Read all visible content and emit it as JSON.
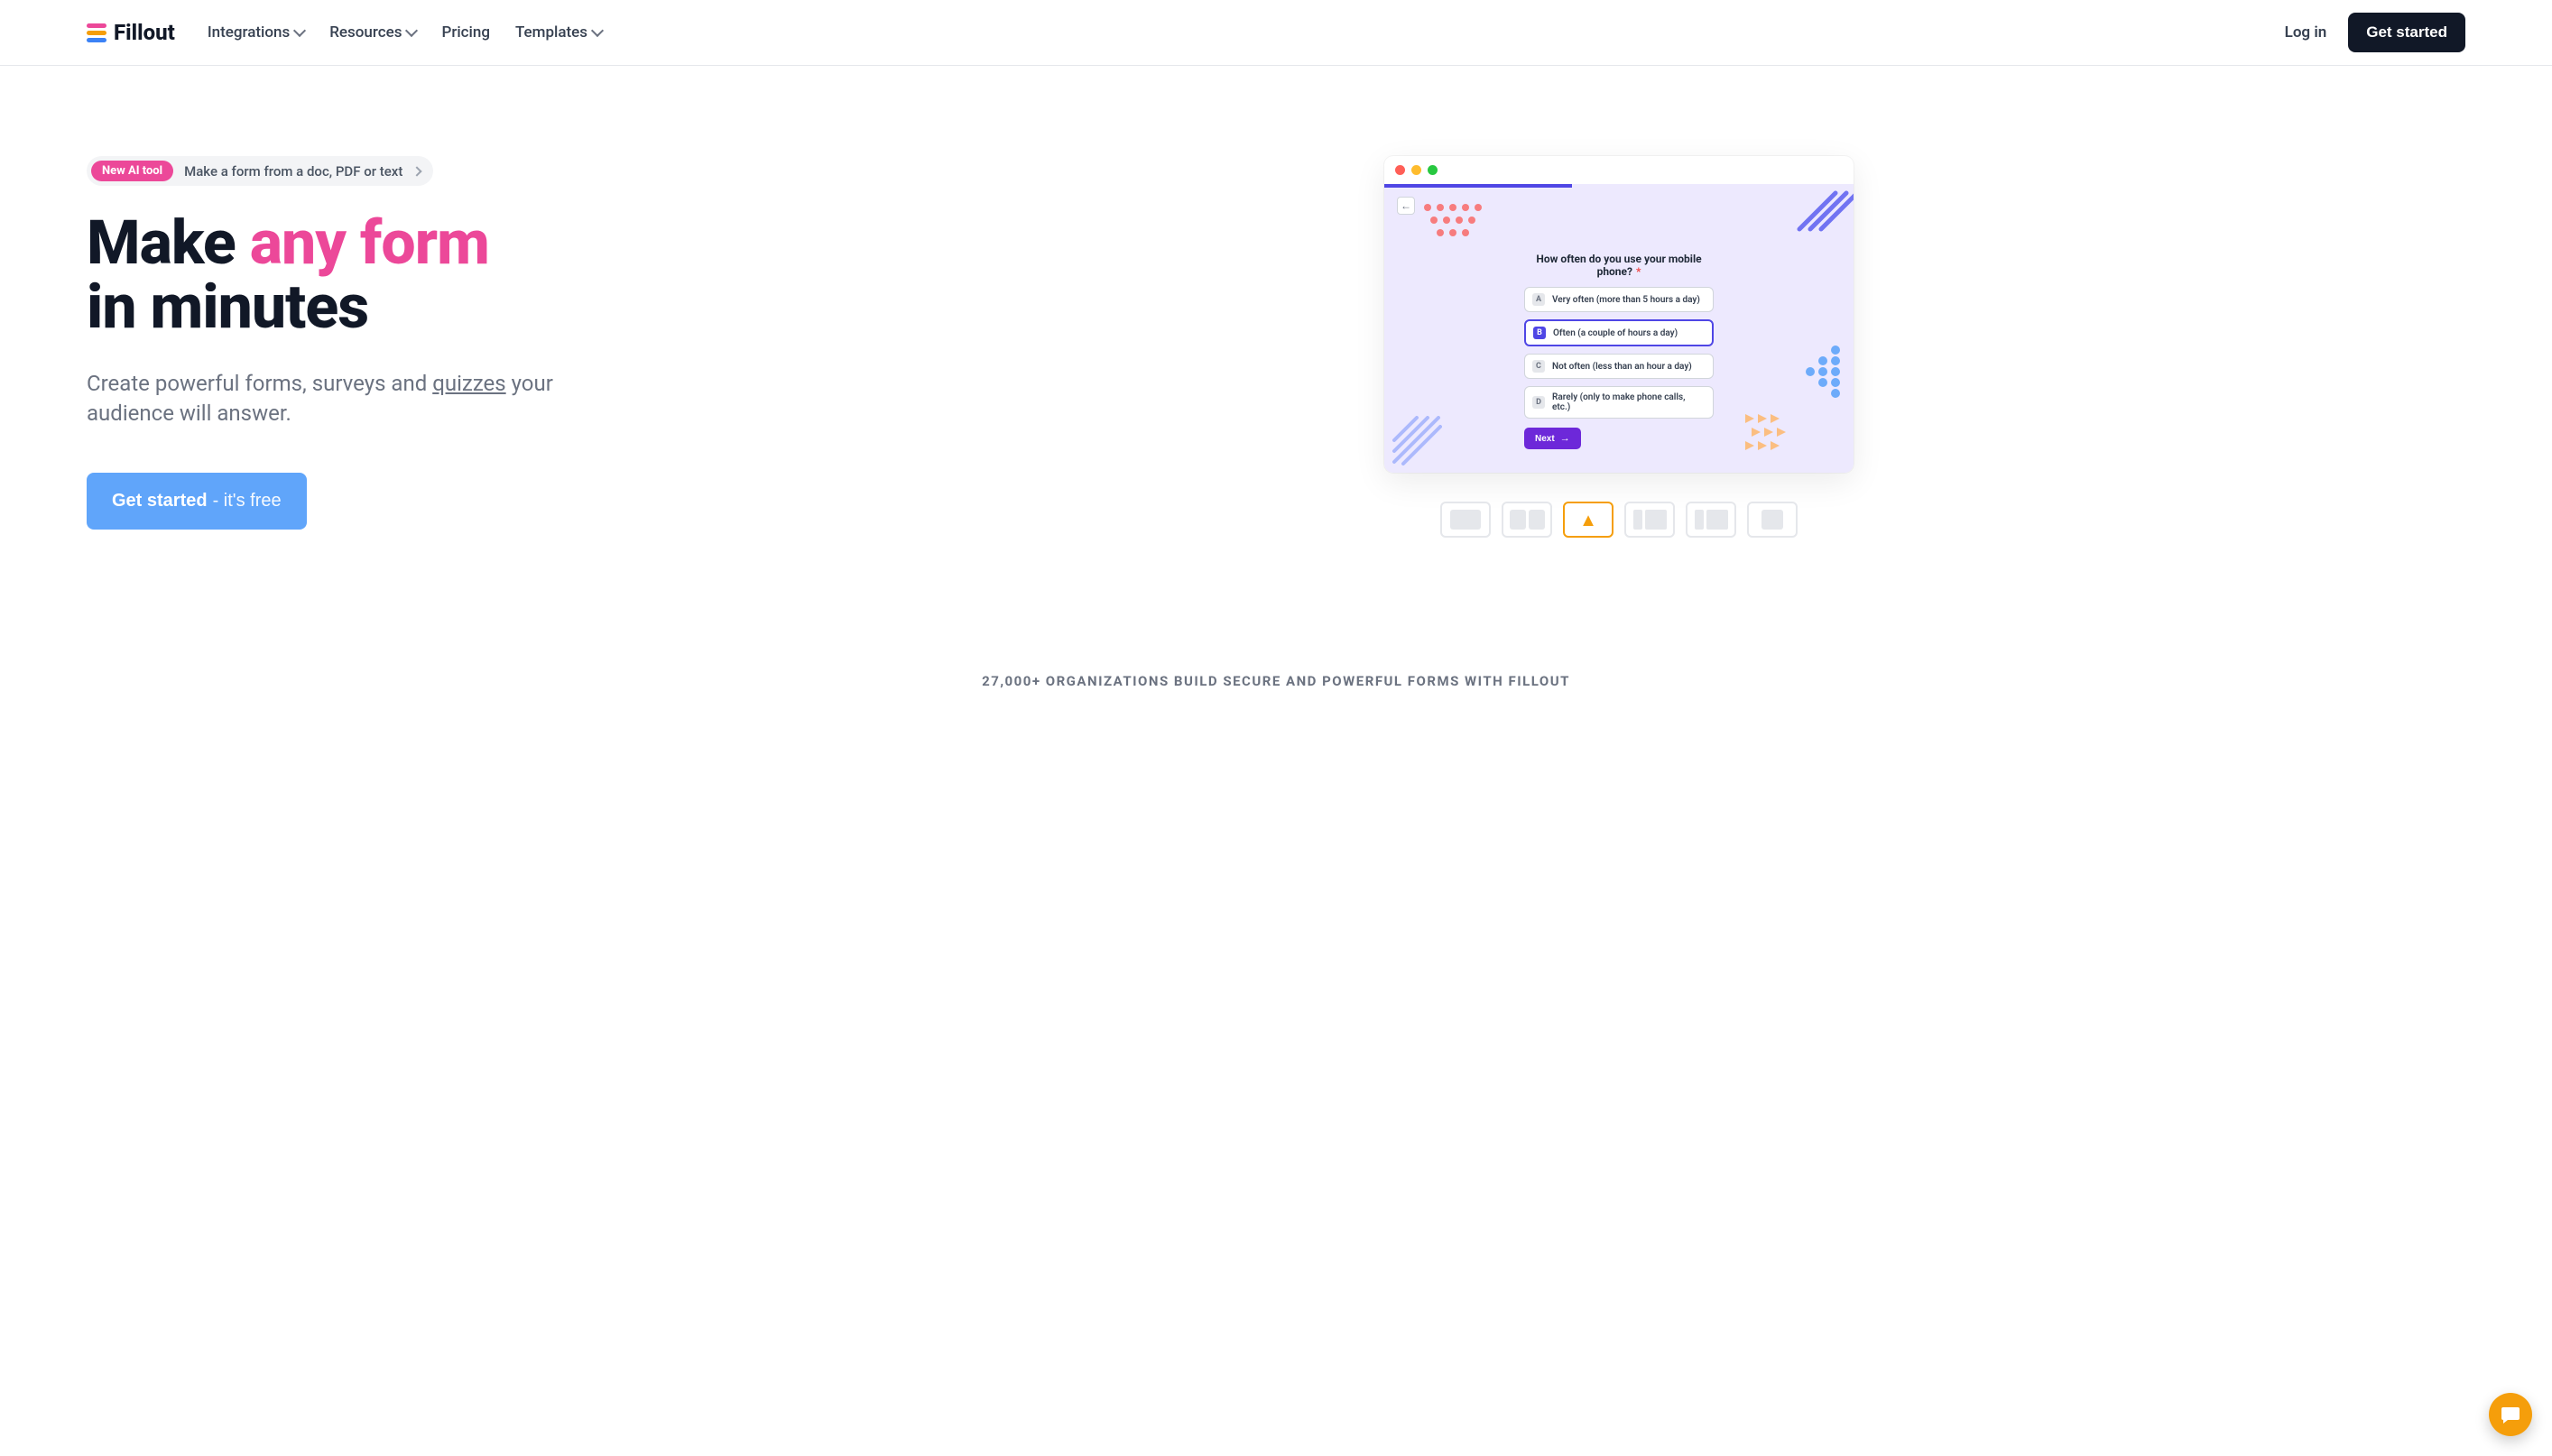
{
  "brand": "Fillout",
  "nav": {
    "integrations": "Integrations",
    "resources": "Resources",
    "pricing": "Pricing",
    "templates": "Templates"
  },
  "auth": {
    "login": "Log in",
    "get_started": "Get started"
  },
  "pill": {
    "badge": "New AI tool",
    "text": "Make a form from a doc, PDF or text"
  },
  "hero": {
    "title_pre": "Make ",
    "title_highlight": "any form",
    "title_post": " in minutes",
    "sub_pre": "Create powerful forms, surveys and ",
    "sub_link": "quizzes",
    "sub_post": " your audience will answer."
  },
  "cta": {
    "strong": "Get started",
    "light": "- it's free"
  },
  "preview": {
    "question": "How often do you use your mobile phone?",
    "options": [
      {
        "key": "A",
        "label": "Very often (more than 5 hours a day)",
        "selected": false
      },
      {
        "key": "B",
        "label": "Often (a couple of hours a day)",
        "selected": true
      },
      {
        "key": "C",
        "label": "Not often (less than an hour a day)",
        "selected": false
      },
      {
        "key": "D",
        "label": "Rarely (only to make phone calls, etc.)",
        "selected": false
      }
    ],
    "next": "Next"
  },
  "thumbs": {
    "active_index": 2
  },
  "proof": "27,000+ organizations build secure and powerful forms with Fillout"
}
